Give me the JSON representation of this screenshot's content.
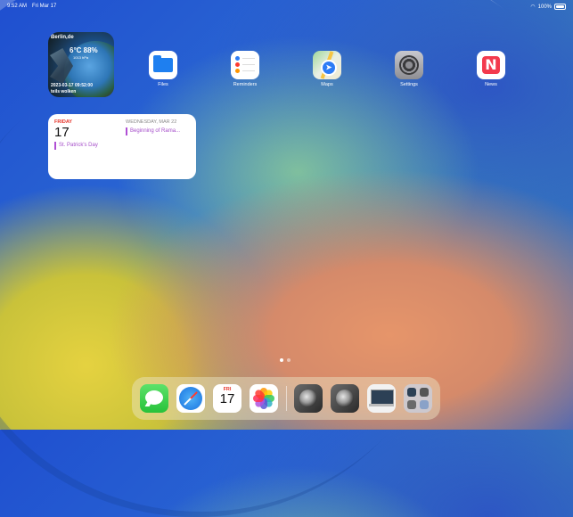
{
  "status_bar": {
    "time": "9:52 AM",
    "date": "Fri Mar 17",
    "battery": "100%"
  },
  "weather_widget": {
    "city": "Berlin,de",
    "temp_humidity": "6°C 88%",
    "small": "1013 hPa",
    "datetime": "2023-03-17 09:52:00",
    "condition": "teils wolken"
  },
  "apps": [
    {
      "label": "Files"
    },
    {
      "label": "Reminders"
    },
    {
      "label": "Maps"
    },
    {
      "label": "Settings"
    },
    {
      "label": "News"
    }
  ],
  "calendar_widget": {
    "today_day": "FRIDAY",
    "today_num": "17",
    "today_event": "St. Patrick's Day",
    "next_header": "WEDNESDAY, MAR 22",
    "next_event": "Beginning of Rama..."
  },
  "dock_calendar": {
    "month": "FRI",
    "day": "17"
  },
  "colors": {
    "calendar_red": "#e6352b",
    "event_purple": "#b04fd4"
  }
}
